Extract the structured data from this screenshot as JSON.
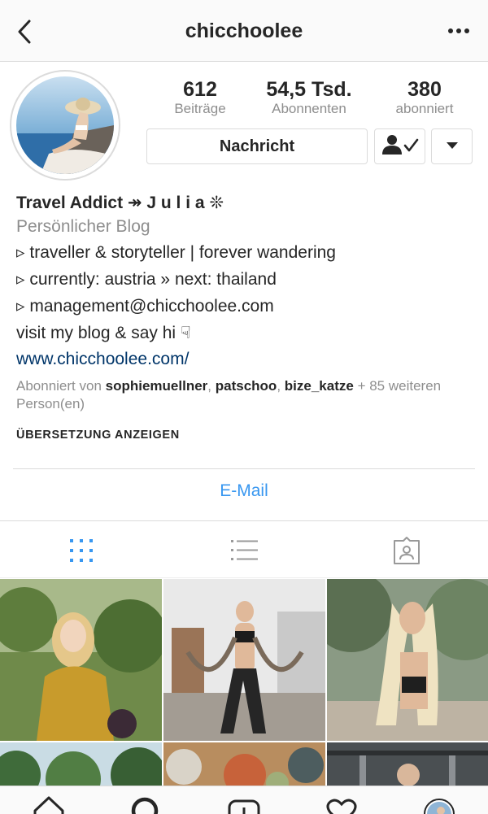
{
  "nav": {
    "title": "chicchoolee",
    "back_icon": "chevron-left-icon",
    "more_icon": "more-options-icon"
  },
  "stats": {
    "posts": {
      "value": "612",
      "label": "Beiträge"
    },
    "followers": {
      "value": "54,5 Tsd.",
      "label": "Abonnenten"
    },
    "following": {
      "value": "380",
      "label": "abonniert"
    }
  },
  "actions": {
    "message_label": "Nachricht",
    "following_icon": "person-check-icon",
    "dropdown_icon": "caret-down-icon"
  },
  "bio": {
    "name": "Travel Addict ↠ J u l i a ❊",
    "category": "Persönlicher Blog",
    "lines": [
      "▹ traveller & storyteller | forever wandering",
      "▹ currently: austria » next: thailand",
      "▹ management@chicchoolee.com",
      "visit my blog & say hi ☟"
    ],
    "website": "www.chicchoolee.com/"
  },
  "followed_by": {
    "prefix": "Abonniert von",
    "users": [
      "sophiemuellner",
      "patschoo",
      "bize_katze"
    ],
    "separator": ",",
    "suffix": "+ 85 weiteren Person(en)"
  },
  "translate_label": "ÜBERSETZUNG ANZEIGEN",
  "email_label": "E-Mail",
  "tabs": [
    "grid-icon",
    "list-icon",
    "tagged-icon"
  ],
  "colors": {
    "link": "#003569",
    "accent_blue": "#3897f0",
    "secondary_text": "#8e8e8e",
    "border": "#dbdbdb"
  },
  "bottom_nav": [
    "home-icon",
    "search-icon",
    "add-icon",
    "heart-icon",
    "profile-avatar-icon"
  ]
}
